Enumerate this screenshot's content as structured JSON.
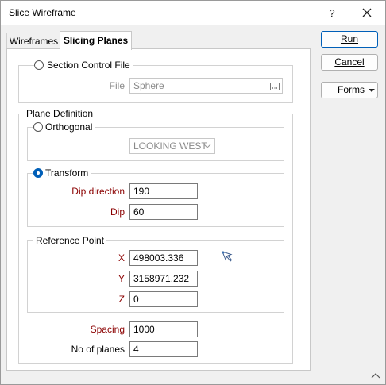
{
  "window": {
    "title": "Slice Wireframe",
    "help": "?"
  },
  "tabs": [
    {
      "label": "Wireframes",
      "active": false
    },
    {
      "label": "Slicing Planes",
      "active": true
    }
  ],
  "buttons": {
    "run": "Run",
    "cancel": "Cancel",
    "forms": "Forms"
  },
  "section_control": {
    "label": "Section Control File",
    "selected": false,
    "file_label": "File",
    "file_value": "Sphere"
  },
  "plane_definition": {
    "label": "Plane Definition",
    "orthogonal": {
      "label": "Orthogonal",
      "selected": false,
      "value": "LOOKING WEST"
    },
    "transform": {
      "label": "Transform",
      "selected": true,
      "dip_direction_label": "Dip direction",
      "dip_direction": "190",
      "dip_label": "Dip",
      "dip": "60"
    },
    "reference_point": {
      "label": "Reference Point",
      "x_label": "X",
      "x": "498003.336",
      "y_label": "Y",
      "y": "3158971.232",
      "z_label": "Z",
      "z": "0"
    },
    "spacing_label": "Spacing",
    "spacing": "1000",
    "num_planes_label": "No of planes",
    "num_planes": "4"
  },
  "colors": {
    "accent": "#005fb8",
    "required_label": "#8b0000"
  }
}
